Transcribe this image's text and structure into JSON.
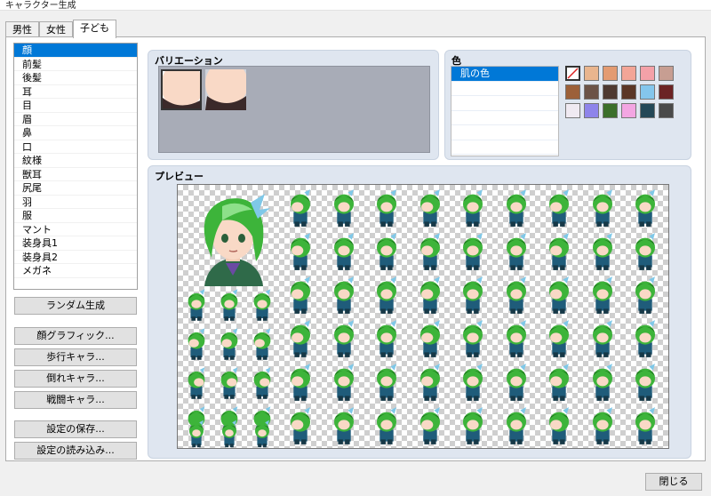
{
  "window": {
    "title": "キャラクター生成"
  },
  "tabs": [
    {
      "label": "男性"
    },
    {
      "label": "女性"
    },
    {
      "label": "子ども"
    }
  ],
  "parts": [
    "顔",
    "前髪",
    "後髪",
    "耳",
    "目",
    "眉",
    "鼻",
    "口",
    "紋様",
    "獣耳",
    "尻尾",
    "羽",
    "服",
    "マント",
    "装身具1",
    "装身具2",
    "メガネ"
  ],
  "selected_part": "顔",
  "buttons": {
    "random": "ランダム生成",
    "face": "顔グラフィック...",
    "walk": "歩行キャラ...",
    "down": "倒れキャラ...",
    "battle": "戦闘キャラ...",
    "save": "設定の保存...",
    "load": "設定の読み込み...",
    "close": "閉じる"
  },
  "variation": {
    "title": "バリエーション"
  },
  "color": {
    "title": "色",
    "items": [
      "肌の色"
    ],
    "swatches": [
      "none",
      "#e9b58e",
      "#e39b72",
      "#f3a597",
      "#f4a1a8",
      "#c79e92",
      "#9c6039",
      "#6c5347",
      "#4e3931",
      "#5b3626",
      "#84c6ec",
      "#6b2324",
      "#f0eaf2",
      "#8e84ea",
      "#3c6f2b",
      "#f3a6e2",
      "#244857",
      "#4a4a4a"
    ]
  },
  "preview": {
    "title": "プレビュー"
  },
  "sprite_colors": {
    "hair": "#3db43a",
    "hair_dark": "#1f7a1f",
    "skin": "#f9d9c6",
    "cloth": "#1f5c7a",
    "cloth_dark": "#163847",
    "ribbon": "#7fc8e8"
  }
}
